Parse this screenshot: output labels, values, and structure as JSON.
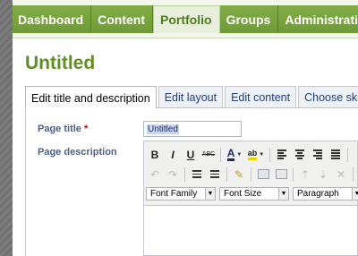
{
  "nav": {
    "items": [
      {
        "label": "Dashboard",
        "active": false
      },
      {
        "label": "Content",
        "active": false
      },
      {
        "label": "Portfolio",
        "active": true
      },
      {
        "label": "Groups",
        "active": false
      },
      {
        "label": "Administrati",
        "active": false
      }
    ]
  },
  "page": {
    "title": "Untitled"
  },
  "tabs": [
    {
      "label": "Edit title and description",
      "active": true
    },
    {
      "label": "Edit layout",
      "active": false
    },
    {
      "label": "Edit content",
      "active": false
    },
    {
      "label": "Choose skin",
      "active": false
    }
  ],
  "form": {
    "page_title_label": "Page title",
    "required_marker": "*",
    "page_title_value": "Untitled",
    "page_description_label": "Page description"
  },
  "editor": {
    "font_family": "Font Family",
    "font_size": "Font Size",
    "format": "Paragraph",
    "buttons": {
      "bold": "B",
      "italic": "I",
      "underline": "U",
      "strike": "ABC",
      "text_color": "A",
      "highlight": "ab"
    }
  },
  "colors": {
    "brand_green": "#74a03a",
    "title_green": "#5e8f23",
    "label_blue": "#4b5f87",
    "required_red": "#cc0000"
  }
}
